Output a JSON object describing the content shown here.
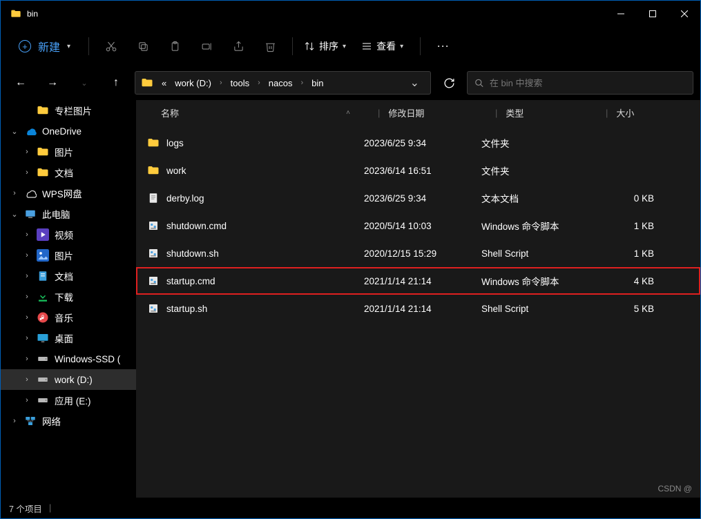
{
  "window": {
    "title": "bin"
  },
  "toolbar": {
    "new_label": "新建",
    "sort_label": "排序",
    "view_label": "查看"
  },
  "breadcrumbs": {
    "prefix": "«",
    "items": [
      "work (D:)",
      "tools",
      "nacos",
      "bin"
    ]
  },
  "search": {
    "placeholder": "在 bin 中搜索"
  },
  "sidebar": {
    "items": [
      {
        "label": "专栏图片",
        "icon": "folder",
        "indent": 1
      },
      {
        "label": "OneDrive",
        "icon": "onedrive",
        "indent": 0,
        "expander": "v"
      },
      {
        "label": "图片",
        "icon": "folder",
        "indent": 1,
        "expander": ">"
      },
      {
        "label": "文档",
        "icon": "folder",
        "indent": 1,
        "expander": ">"
      },
      {
        "label": "WPS网盘",
        "icon": "wps",
        "indent": 0,
        "expander": ">"
      },
      {
        "label": "此电脑",
        "icon": "pc",
        "indent": 0,
        "expander": "v"
      },
      {
        "label": "视频",
        "icon": "video",
        "indent": 1,
        "expander": ">"
      },
      {
        "label": "图片",
        "icon": "pictures",
        "indent": 1,
        "expander": ">"
      },
      {
        "label": "文档",
        "icon": "docs",
        "indent": 1,
        "expander": ">"
      },
      {
        "label": "下载",
        "icon": "download",
        "indent": 1,
        "expander": ">"
      },
      {
        "label": "音乐",
        "icon": "music",
        "indent": 1,
        "expander": ">"
      },
      {
        "label": "桌面",
        "icon": "desktop",
        "indent": 1,
        "expander": ">"
      },
      {
        "label": "Windows-SSD (",
        "icon": "disk",
        "indent": 1,
        "expander": ">"
      },
      {
        "label": "work (D:)",
        "icon": "disk",
        "indent": 1,
        "expander": ">",
        "selected": true
      },
      {
        "label": "应用 (E:)",
        "icon": "disk",
        "indent": 1,
        "expander": ">"
      },
      {
        "label": "网络",
        "icon": "network",
        "indent": 0,
        "expander": ">"
      }
    ]
  },
  "columns": {
    "name": "名称",
    "date": "修改日期",
    "type": "类型",
    "size": "大小"
  },
  "files": [
    {
      "name": "logs",
      "date": "2023/6/25 9:34",
      "type": "文件夹",
      "size": "",
      "icon": "folder"
    },
    {
      "name": "work",
      "date": "2023/6/14 16:51",
      "type": "文件夹",
      "size": "",
      "icon": "folder"
    },
    {
      "name": "derby.log",
      "date": "2023/6/25 9:34",
      "type": "文本文档",
      "size": "0 KB",
      "icon": "text"
    },
    {
      "name": "shutdown.cmd",
      "date": "2020/5/14 10:03",
      "type": "Windows 命令脚本",
      "size": "1 KB",
      "icon": "cmd"
    },
    {
      "name": "shutdown.sh",
      "date": "2020/12/15 15:29",
      "type": "Shell Script",
      "size": "1 KB",
      "icon": "cmd"
    },
    {
      "name": "startup.cmd",
      "date": "2021/1/14 21:14",
      "type": "Windows 命令脚本",
      "size": "4 KB",
      "icon": "cmd",
      "highlight": true
    },
    {
      "name": "startup.sh",
      "date": "2021/1/14 21:14",
      "type": "Shell Script",
      "size": "5 KB",
      "icon": "cmd"
    }
  ],
  "status": {
    "count": "7 个项目"
  },
  "watermark": "CSDN @"
}
